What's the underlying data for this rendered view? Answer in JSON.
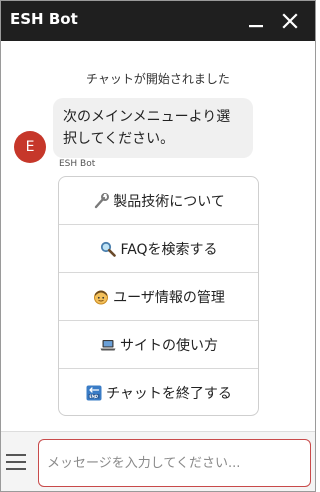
{
  "window": {
    "title": "ESH Bot"
  },
  "chat": {
    "system_message": "チャットが開始されました",
    "avatar_letter": "E",
    "bot_message_line1": "次のメインメニューより選",
    "bot_message_line2": "択してください。",
    "sender_name": "ESH Bot"
  },
  "menu": {
    "items": [
      {
        "label": "製品技術について",
        "icon": "wrench-icon"
      },
      {
        "label": "FAQを検索する",
        "icon": "magnifier-icon"
      },
      {
        "label": "ユーザ情報の管理",
        "icon": "face-icon"
      },
      {
        "label": "サイトの使い方",
        "icon": "laptop-icon"
      },
      {
        "label": "チャットを終了する",
        "icon": "end-arrow-icon"
      }
    ]
  },
  "composer": {
    "placeholder": "メッセージを入力してください..."
  },
  "colors": {
    "titlebar": "#1f1f1f",
    "avatar": "#c6372a",
    "input_border": "#c84a4a",
    "bubble": "#f0f0f0"
  }
}
